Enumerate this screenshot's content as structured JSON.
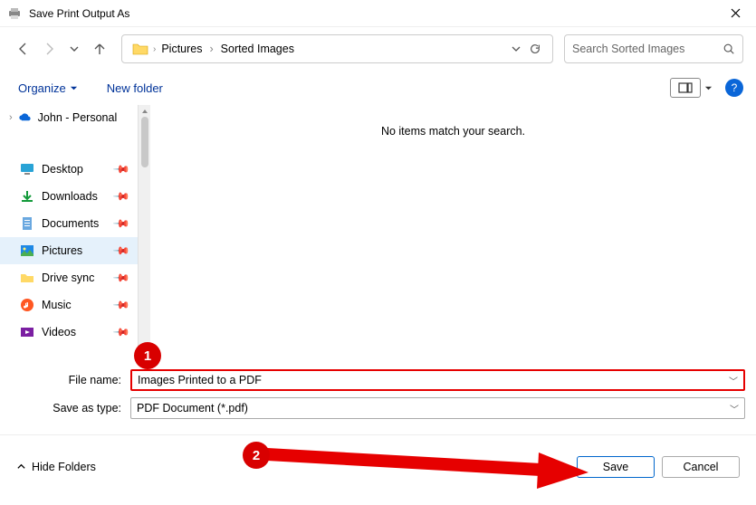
{
  "window": {
    "title": "Save Print Output As"
  },
  "breadcrumb": {
    "seg1": "Pictures",
    "seg2": "Sorted Images"
  },
  "search": {
    "placeholder": "Search Sorted Images"
  },
  "toolbar": {
    "organize": "Organize",
    "newfolder": "New folder"
  },
  "tree": {
    "root": "John - Personal"
  },
  "sidebar": {
    "items": [
      {
        "label": "Desktop"
      },
      {
        "label": "Downloads"
      },
      {
        "label": "Documents"
      },
      {
        "label": "Pictures"
      },
      {
        "label": "Drive sync"
      },
      {
        "label": "Music"
      },
      {
        "label": "Videos"
      }
    ]
  },
  "content": {
    "empty": "No items match your search."
  },
  "form": {
    "filename_label": "File name:",
    "filename_value": "Images Printed to a PDF",
    "type_label": "Save as type:",
    "type_value": "PDF Document (*.pdf)"
  },
  "footer": {
    "hide": "Hide Folders",
    "save": "Save",
    "cancel": "Cancel"
  },
  "annotations": {
    "badge1": "1",
    "badge2": "2"
  }
}
